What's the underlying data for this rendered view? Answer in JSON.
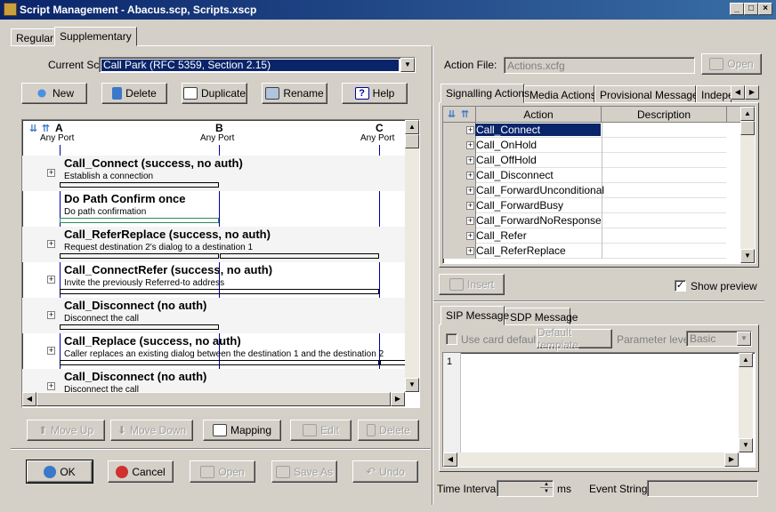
{
  "window": {
    "title": "Script Management - Abacus.scp, Scripts.xscp"
  },
  "top_tabs": [
    {
      "label": "Regular"
    },
    {
      "label": "Supplementary"
    }
  ],
  "script": {
    "label": "Current Script:",
    "value": "Call Park (RFC 5359, Section 2.15)"
  },
  "toolbar": {
    "new": "New",
    "delete": "Delete",
    "duplicate": "Duplicate",
    "rename": "Rename",
    "help": "Help"
  },
  "flow": {
    "columns": [
      {
        "name": "A",
        "port": "Any Port"
      },
      {
        "name": "B",
        "port": "Any Port"
      },
      {
        "name": "C",
        "port": "Any Port"
      }
    ],
    "steps": [
      {
        "title": "Call_Connect (success, no auth)",
        "desc": "Establish a connection"
      },
      {
        "title": "Do Path Confirm once",
        "desc": "Do path confirmation"
      },
      {
        "title": "Call_ReferReplace (success, no auth)",
        "desc": "Request destination 2's dialog to a destination 1"
      },
      {
        "title": "Call_ConnectRefer (success, no auth)",
        "desc": "Invite the previously Referred-to address"
      },
      {
        "title": "Call_Disconnect (no auth)",
        "desc": "Disconnect the call"
      },
      {
        "title": "Call_Replace (success, no auth)",
        "desc": "Caller replaces an existing dialog between the destination 1 and the destination 2"
      },
      {
        "title": "Call_Disconnect (no auth)",
        "desc": "Disconnect the call"
      }
    ]
  },
  "flow_buttons": {
    "move_up": "Move Up",
    "move_down": "Move Down",
    "mapping": "Mapping",
    "edit": "Edit",
    "delete": "Delete"
  },
  "bottom_buttons": {
    "ok": "OK",
    "cancel": "Cancel",
    "open": "Open",
    "save_as": "Save As",
    "undo": "Undo"
  },
  "action_file": {
    "label": "Action File:",
    "value": "Actions.xcfg",
    "open": "Open"
  },
  "action_tabs": [
    {
      "label": "Signalling Actions"
    },
    {
      "label": "Media Actions"
    },
    {
      "label": "Provisional Messages"
    },
    {
      "label": "Indepe"
    }
  ],
  "action_grid": {
    "headers": {
      "action": "Action",
      "description": "Description"
    },
    "rows": [
      "Call_Connect",
      "Call_OnHold",
      "Call_OffHold",
      "Call_Disconnect",
      "Call_ForwardUnconditional",
      "Call_ForwardBusy",
      "Call_ForwardNoResponse",
      "Call_Refer",
      "Call_ReferReplace"
    ]
  },
  "insert": "Insert",
  "show_preview": {
    "label": "Show preview",
    "checked": true
  },
  "message_tabs": [
    {
      "label": "SIP Message"
    },
    {
      "label": "SDP Message"
    }
  ],
  "message": {
    "use_card_default": "Use card default",
    "default_template": "Default template",
    "parameter_level_label": "Parameter level",
    "parameter_level_value": "Basic",
    "line_number": "1"
  },
  "footer": {
    "time_interval": "Time Interval",
    "ms": "ms",
    "event_string": "Event String"
  },
  "colors": {
    "titlebar": "#0a246a",
    "selection": "#0a246a",
    "flow_line": "#0000a0",
    "confirm_arrow": "#2e8b57"
  }
}
